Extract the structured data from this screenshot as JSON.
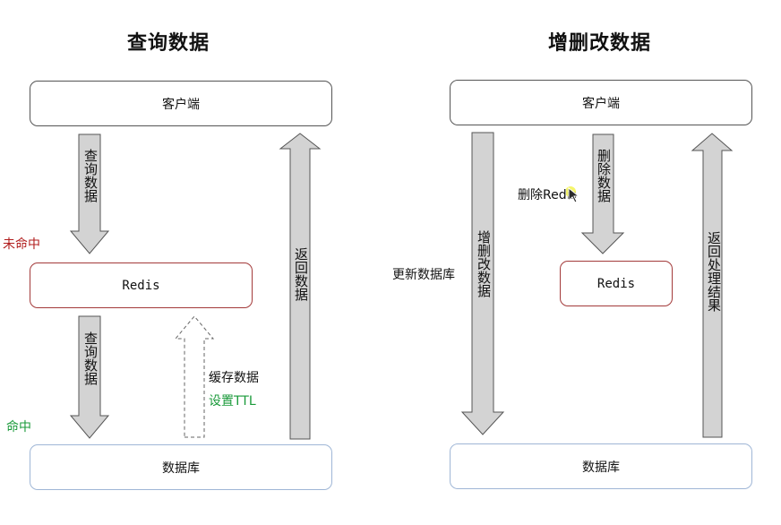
{
  "left": {
    "title": "查询数据",
    "client": "客户端",
    "redis": "Redis",
    "db": "数据库",
    "arrow_query_top": "查询数据",
    "arrow_query_bottom": "查询数据",
    "arrow_return": "返回数据",
    "miss_label": "未命中",
    "hit_label": "命中",
    "cache_label": "缓存数据",
    "ttl_label": "设置TTL"
  },
  "right": {
    "title": "增删改数据",
    "client": "客户端",
    "redis": "Redis",
    "db": "数据库",
    "arrow_modify": "增删改数据",
    "arrow_delete": "删除数据",
    "arrow_return": "返回处理结果",
    "update_db_label": "更新数据库",
    "delete_redis_label": "删除Redis"
  },
  "colors": {
    "arrow_fill": "#d3d3d3",
    "arrow_stroke": "#555555",
    "miss": "#b11d1d",
    "hit": "#1a9a3a",
    "redis_border": "#a33a3a",
    "db_border": "#9fb6d6"
  }
}
